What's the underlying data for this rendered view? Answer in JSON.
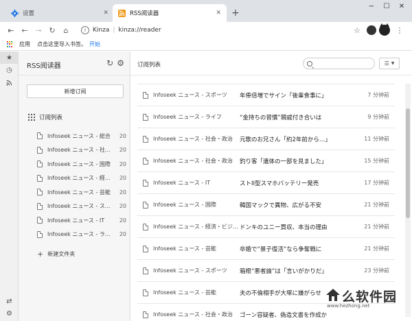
{
  "tabs": [
    {
      "title": "设置",
      "icon": "gear-icon",
      "active": false
    },
    {
      "title": "RSS阅读器",
      "icon": "rss-icon",
      "active": true
    }
  ],
  "colors": {
    "tab_icon_blue": "#1a73e8",
    "rss_orange": "#f29b1d",
    "accent_blue": "#1a73e8"
  },
  "omnibox": {
    "site": "Kinza",
    "url": "kinza://reader"
  },
  "bookmarks": {
    "apps_label": "应用",
    "import_hint": "点击这里导入书签。",
    "start_link": "开始"
  },
  "sidebar": {
    "title": "RSS阅读器",
    "new_subscription": "新增订阅",
    "subscriptions_header": "订阅列表",
    "feeds": [
      {
        "name": "Infoseek ニュース - 総合",
        "count": "20"
      },
      {
        "name": "Infoseek ニュース - 社…",
        "count": "20"
      },
      {
        "name": "Infoseek ニュース - 国際",
        "count": "20"
      },
      {
        "name": "Infoseek ニュース - 経…",
        "count": "20"
      },
      {
        "name": "Infoseek ニュース - 芸能",
        "count": "20"
      },
      {
        "name": "Infoseek ニュース - ス…",
        "count": "20"
      },
      {
        "name": "Infoseek ニュース - IT",
        "count": "20"
      },
      {
        "name": "Infoseek ニュース - ラ…",
        "count": "20"
      }
    ],
    "new_folder": "新建文件夹"
  },
  "main": {
    "title": "订阅列表",
    "articles": [
      {
        "source": "Infoseek ニュース - スポーツ",
        "title": "年俸倍増でサイン「後輩食事に」",
        "time": "7 分钟前"
      },
      {
        "source": "Infoseek ニュース - ライフ",
        "title": "“金持ちの習慣”親戚付き合いは",
        "time": "9 分钟前"
      },
      {
        "source": "Infoseek ニュース - 社会・政治",
        "title": "元歌のお兄さん「約2年前から…」",
        "time": "11 分钟前"
      },
      {
        "source": "Infoseek ニュース - 社会・政治",
        "title": "釣り客「遺体の一部を見ました」",
        "time": "15 分钟前"
      },
      {
        "source": "Infoseek ニュース - IT",
        "title": "ストII型スマホバッテリー発売",
        "time": "17 分钟前"
      },
      {
        "source": "Infoseek ニュース - 国際",
        "title": "韓国マックで異物、広がる不安",
        "time": "21 分钟前"
      },
      {
        "source": "Infoseek ニュース - 経済・ビジ…",
        "title": "ドンキのユニー買収、本当の理由",
        "time": "21 分钟前"
      },
      {
        "source": "Infoseek ニュース - 芸能",
        "title": "卒婚で“景子復活”なら争奪戦に",
        "time": "21 分钟前"
      },
      {
        "source": "Infoseek ニュース - スポーツ",
        "title": "箱根“悪者論”は「言いがかりだ」",
        "time": "23 分钟前"
      },
      {
        "source": "Infoseek ニュース - 芸能",
        "title": "夫の不倫相手が大塚に嫌がらせ",
        "time": ""
      },
      {
        "source": "Infoseek ニュース - 社会・政治",
        "title": "ゴーン容疑者、偽造文書を作成か",
        "time": ""
      }
    ]
  },
  "watermark": {
    "text": "么软件园",
    "url": "www.hezhong.net"
  }
}
